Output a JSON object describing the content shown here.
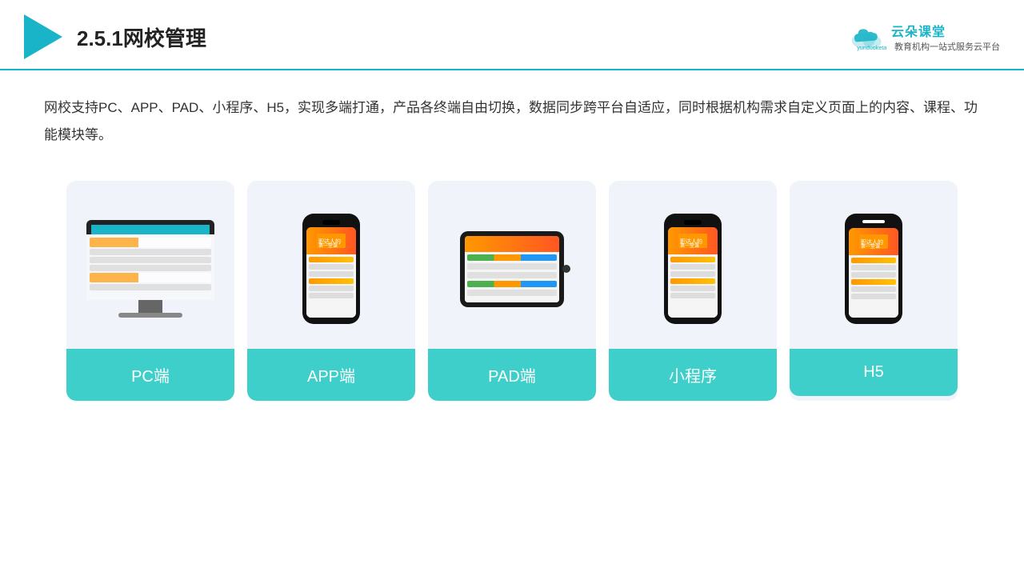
{
  "header": {
    "title": "2.5.1网校管理",
    "brand": {
      "name": "云朵课堂",
      "url": "yunduoketang.com",
      "slogan": "教育机构一站\n式服务云平台"
    }
  },
  "description": "网校支持PC、APP、PAD、小程序、H5，实现多端打通，产品各终端自由切换，数据同步跨平台自适应，同时根据机构需求自定义页面上的内容、课程、功能模块等。",
  "cards": [
    {
      "id": "pc",
      "label": "PC端"
    },
    {
      "id": "app",
      "label": "APP端"
    },
    {
      "id": "pad",
      "label": "PAD端"
    },
    {
      "id": "mini",
      "label": "小程序"
    },
    {
      "id": "h5",
      "label": "H5"
    }
  ],
  "colors": {
    "accent": "#1ab4c8",
    "card_bg": "#eef2f8",
    "card_label_bg": "#3ecfca"
  }
}
